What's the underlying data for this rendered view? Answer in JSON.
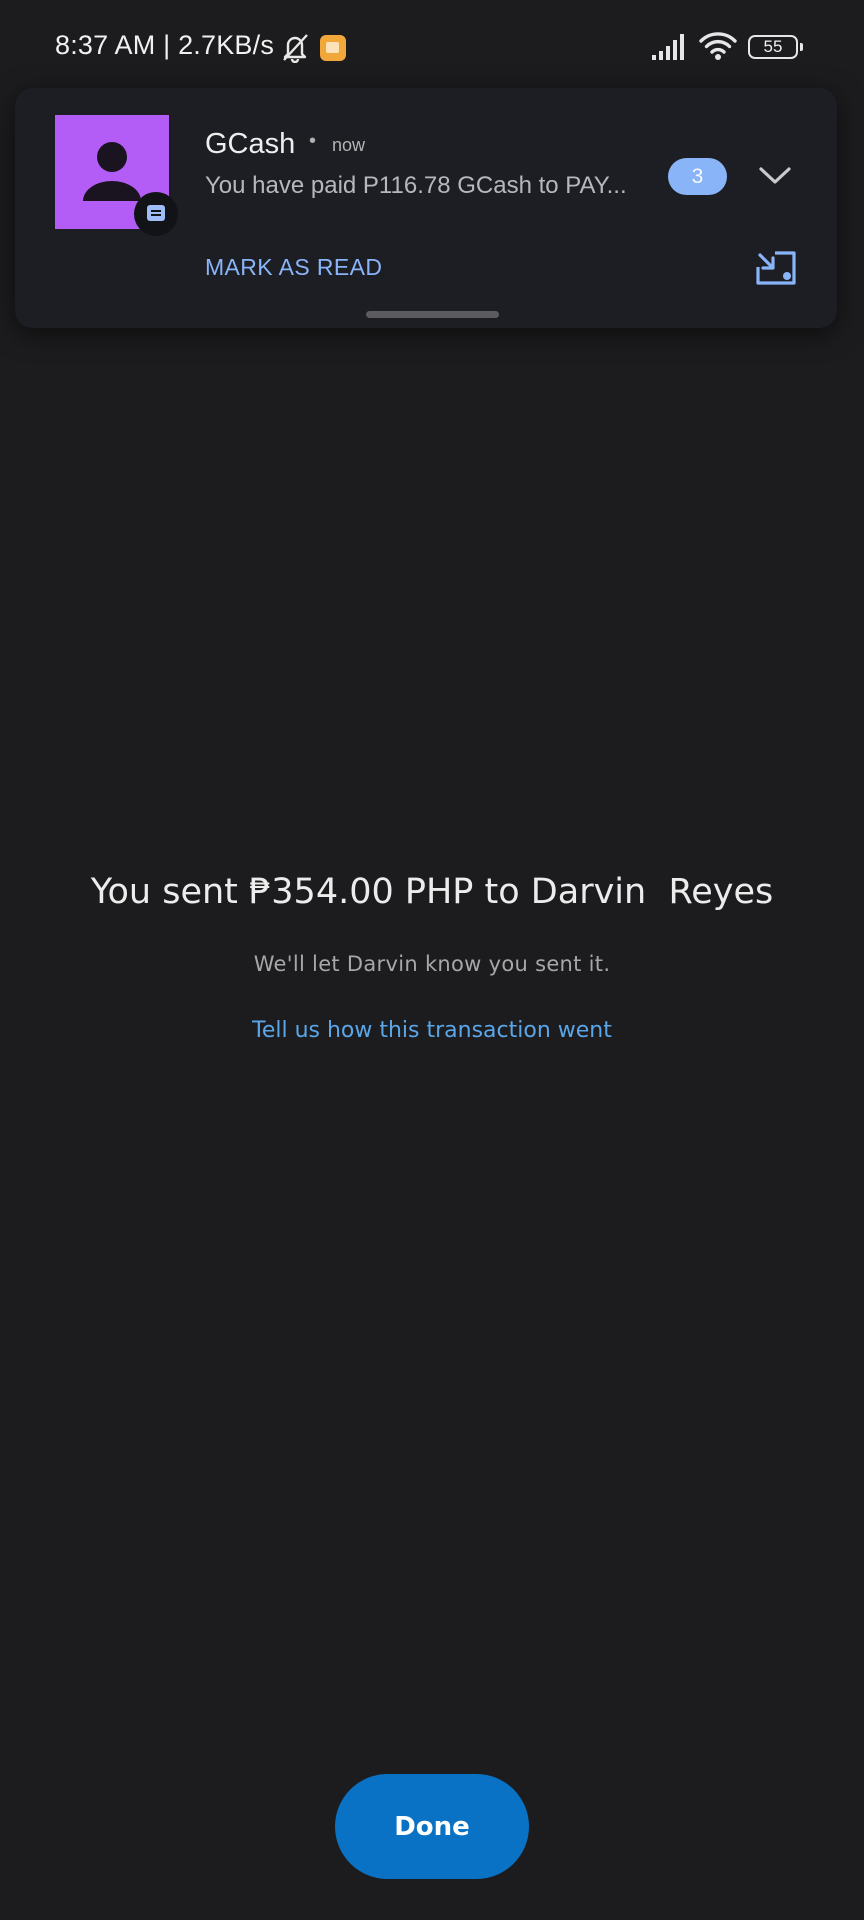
{
  "status_bar": {
    "time_speed": "8:37 AM | 2.7KB/s",
    "battery_level": "55",
    "icons": [
      "bell-off-icon",
      "notes-app-icon",
      "signal-icon",
      "wifi-icon",
      "battery-icon"
    ]
  },
  "notification": {
    "app_name": "GCash",
    "separator": "•",
    "time": "now",
    "body": "You have paid P116.78 GCash to PAY...",
    "count": "3",
    "action_label": "MARK AS READ",
    "avatar_color": "#b35cf6",
    "accent_color": "#8ab4f8"
  },
  "main": {
    "title": "You sent ₱354.00 PHP to Darvin  Reyes",
    "subtitle": "We'll let Darvin know you sent it.",
    "feedback_link": "Tell us how this transaction went",
    "link_color": "#5aa6e8"
  },
  "footer": {
    "done_label": "Done",
    "button_color": "#0a72c4"
  }
}
